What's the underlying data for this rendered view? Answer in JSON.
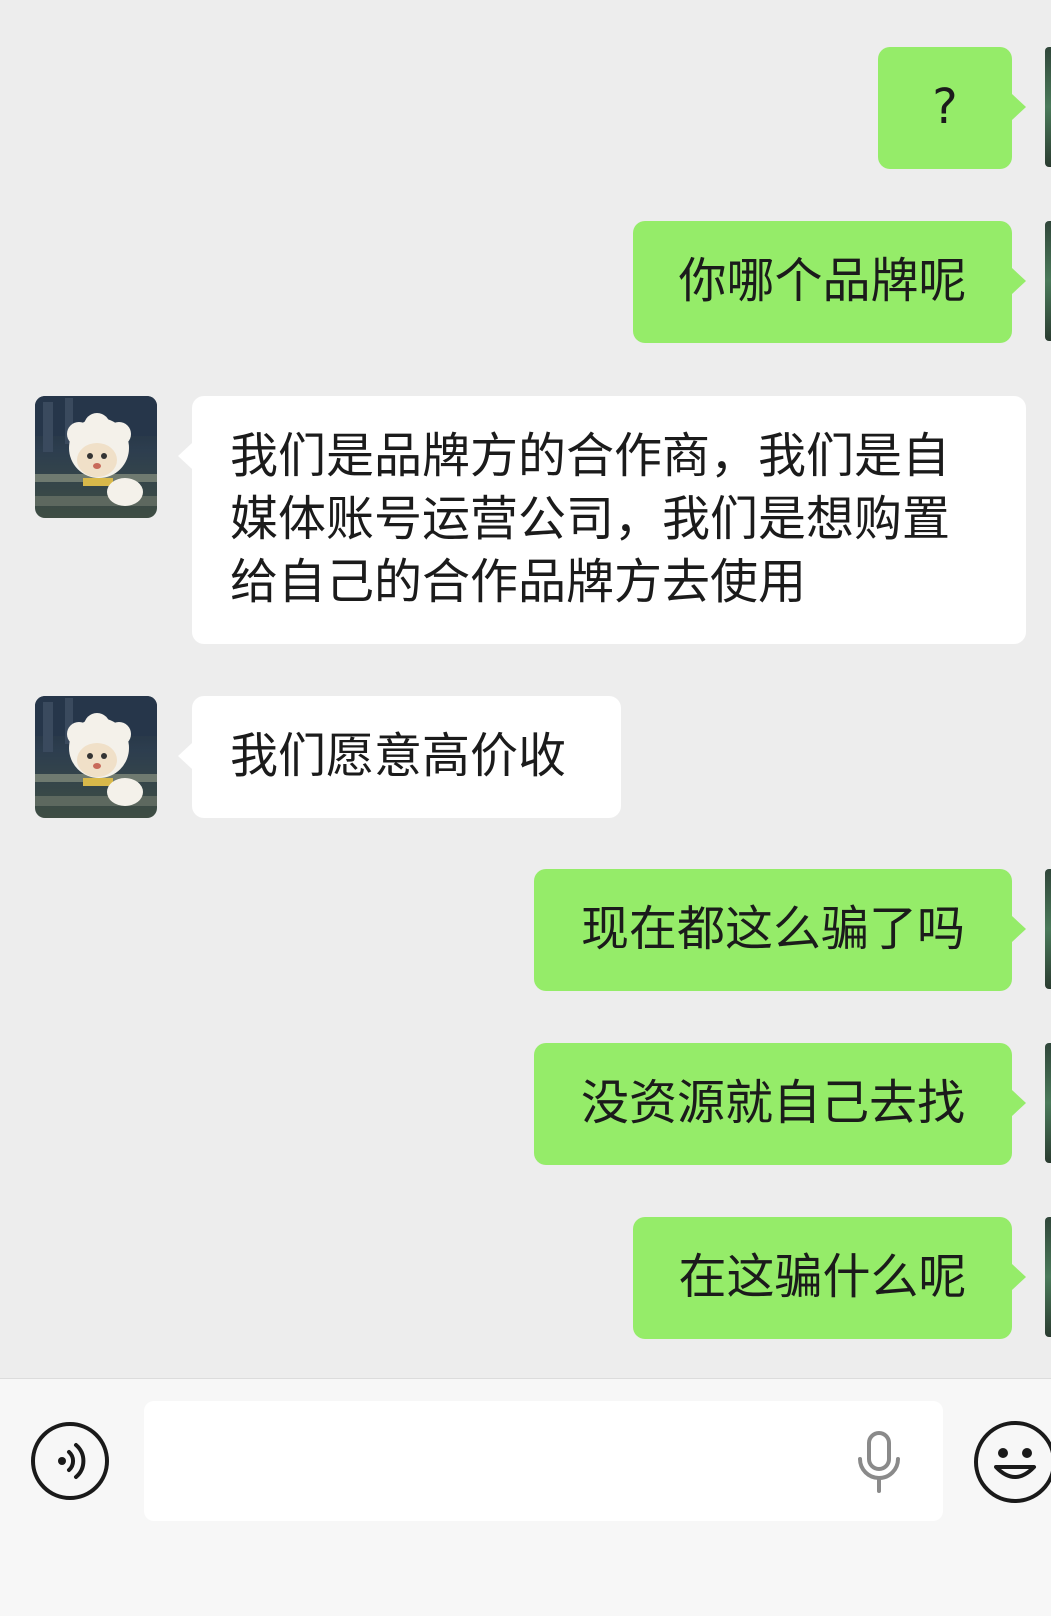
{
  "conversation": {
    "messages": [
      {
        "direction": "outgoing",
        "text": "?"
      },
      {
        "direction": "outgoing",
        "text": "你哪个品牌呢"
      },
      {
        "direction": "incoming",
        "text": "我们是品牌方的合作商，我们是自媒体账号运营公司，我们是想购置给自己的合作品牌方去使用"
      },
      {
        "direction": "incoming",
        "text": "我们愿意高价收"
      },
      {
        "direction": "outgoing",
        "text": "现在都这么骗了吗"
      },
      {
        "direction": "outgoing",
        "text": "没资源就自己去找"
      },
      {
        "direction": "outgoing",
        "text": "在这骗什么呢"
      }
    ]
  },
  "colors": {
    "background": "#ededed",
    "outgoing_bubble": "#95ec69",
    "incoming_bubble": "#ffffff",
    "input_bar": "#f7f7f7"
  },
  "icons": {
    "voice": "voice-toggle-icon",
    "microphone": "microphone-icon",
    "emoji": "emoji-icon"
  }
}
